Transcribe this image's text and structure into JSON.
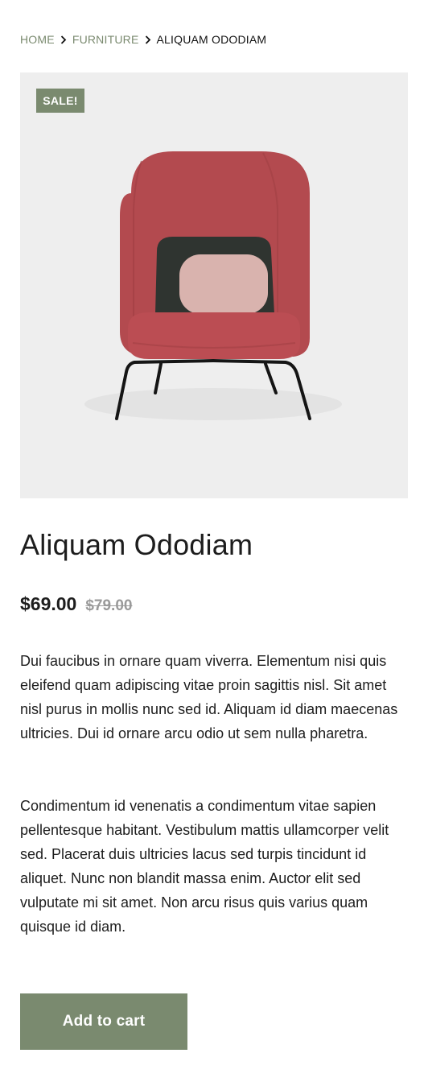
{
  "breadcrumb": {
    "home": "HOME",
    "category": "FURNITURE",
    "current": "ALIQUAM ODODIAM"
  },
  "product": {
    "badge": "SALE!",
    "title": "Aliquam Ododiam",
    "price": "$69.00",
    "old_price": "$79.00",
    "description_1": "Dui faucibus in ornare quam viverra. Elementum nisi quis eleifend quam adipiscing vitae proin sagittis nisl. Sit amet nisl purus in mollis nunc sed id. Aliquam id diam maecenas ultricies. Dui id ornare arcu odio ut sem nulla pharetra.",
    "description_2": "Condimentum id venenatis a condimentum vitae sapien pellentesque habitant. Vestibulum mattis ullamcorper velit sed. Placerat duis ultricies lacus sed turpis tincidunt id aliquet. Nunc non blandit massa enim. Auctor elit sed vulputate mi sit amet. Non arcu risus quis varius quam quisque id diam."
  },
  "cart": {
    "add_label": "Add to cart"
  },
  "colors": {
    "accent": "#7a8a6f",
    "image_bg": "#eeeeee",
    "chair": "#b34a4f",
    "cushion_dark": "#2f3430",
    "cushion_light": "#d9b3ae"
  },
  "icons": {
    "separator": "chevron-right-icon"
  }
}
